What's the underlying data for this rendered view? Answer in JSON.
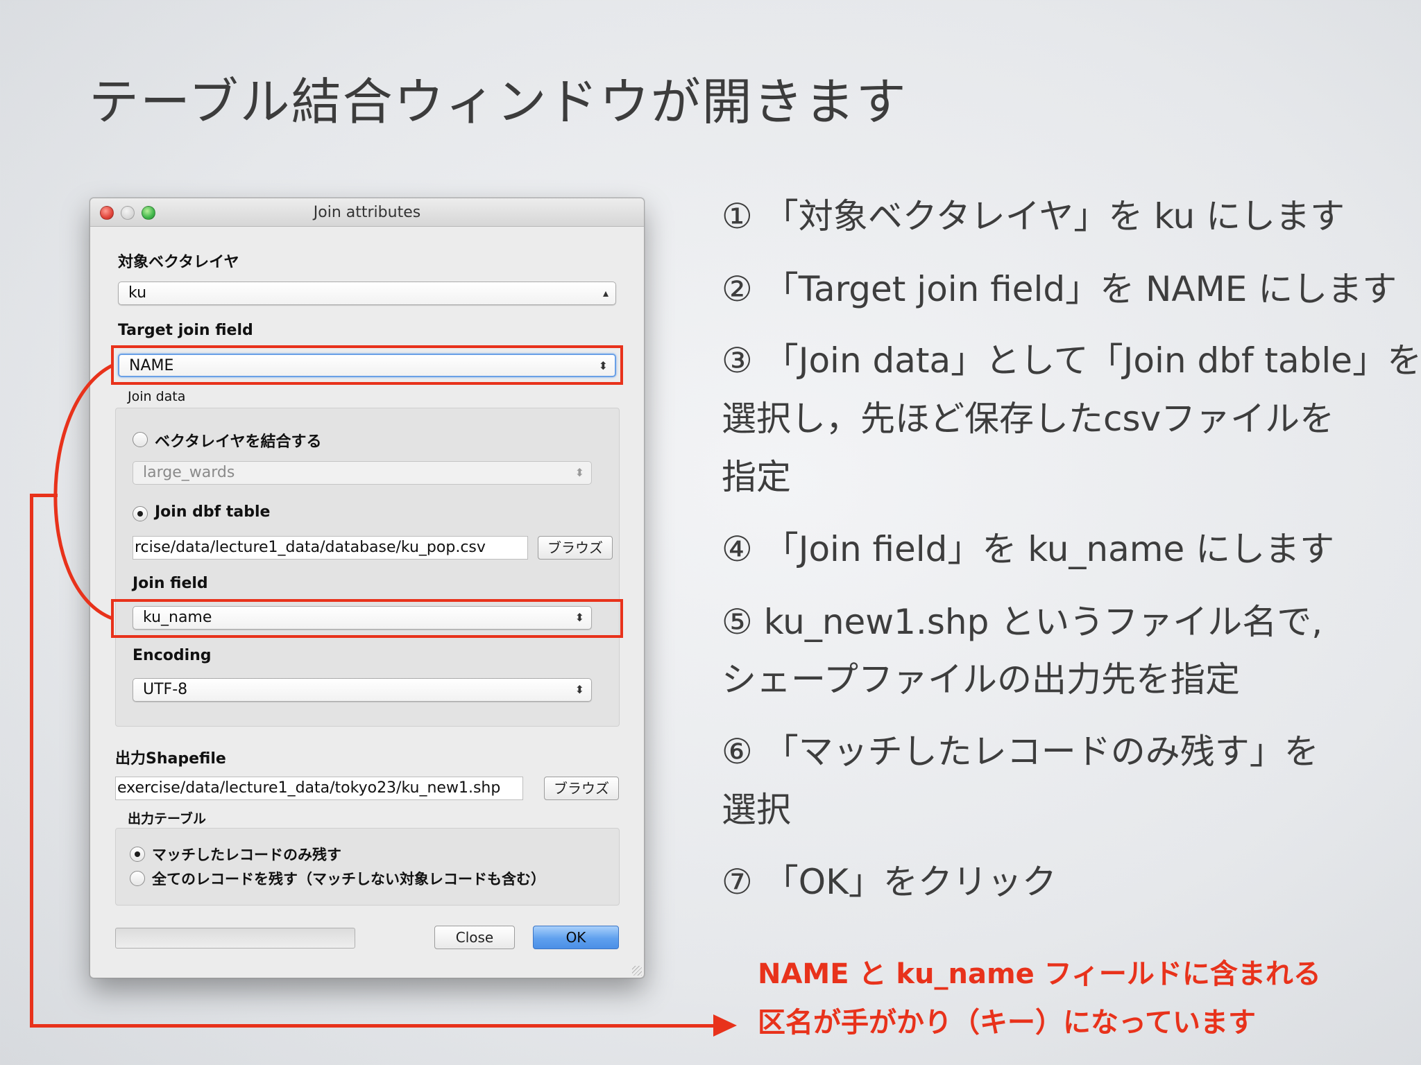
{
  "slide": {
    "title": "テーブル結合ウィンドウが開きます"
  },
  "dialog": {
    "window_title": "Join attributes",
    "target_layer_label": "対象ベクタレイヤ",
    "target_layer_value": "ku",
    "target_join_field_label": "Target join field",
    "target_join_field_value": "NAME",
    "join_data_label": "Join data",
    "radio_join_vector_label": "ベクタレイヤを結合する",
    "join_vector_value": "large_wards",
    "radio_join_dbf_label": "Join dbf table",
    "dbf_path_value": "rcise/data/lecture1_data/database/ku_pop.csv",
    "browse_label": "ブラウズ",
    "join_field_label": "Join field",
    "join_field_value": "ku_name",
    "encoding_label": "Encoding",
    "encoding_value": "UTF-8",
    "output_shapefile_label": "出力Shapefile",
    "output_path_value": "exercise/data/lecture1_data/tokyo23/ku_new1.shp",
    "output_table_label": "出力テーブル",
    "radio_matching_label": "マッチしたレコードのみ残す",
    "radio_all_label": "全てのレコードを残す（マッチしない対象レコードも含む）",
    "close_label": "Close",
    "ok_label": "OK",
    "selected_join_source": "Join dbf table",
    "selected_output_option": "マッチしたレコードのみ残す"
  },
  "instructions": [
    "① 「対象ベクタレイヤ」を ku にします",
    "② 「Target join field」を NAME にします",
    "③ 「Join data」として「Join dbf table」を",
    "選択し，先ほど保存したcsvファイルを",
    "指定",
    "④ 「Join field」を ku_name にします",
    "⑤ ku_new1.shp というファイル名で,",
    "シェープファイルの出力先を指定",
    "⑥ 「マッチしたレコードのみ残す」を",
    "選択",
    "⑦ 「OK」をクリック"
  ],
  "note": {
    "line1": "NAME と ku_name フィールドに含まれる",
    "line2": "区名が手がかり（キー）になっています"
  },
  "colors": {
    "annotation_red": "#e8321b",
    "ok_button_blue": "#5fa0ee"
  }
}
